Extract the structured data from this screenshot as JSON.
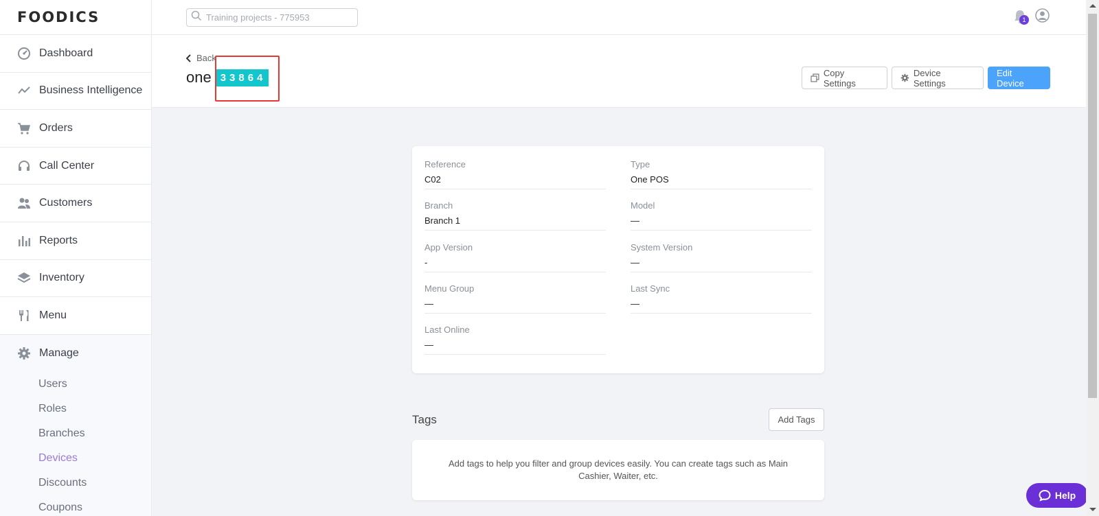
{
  "app": {
    "logo": "FOODICS"
  },
  "search": {
    "placeholder": "Training projects - 775953"
  },
  "notifications": {
    "count": "1"
  },
  "sidebar": {
    "items": [
      {
        "label": "Dashboard",
        "icon": "dashboard-icon"
      },
      {
        "label": "Business Intelligence",
        "icon": "trend-icon"
      },
      {
        "label": "Orders",
        "icon": "cart-icon"
      },
      {
        "label": "Call Center",
        "icon": "headset-icon"
      },
      {
        "label": "Customers",
        "icon": "customers-icon"
      },
      {
        "label": "Reports",
        "icon": "bar-chart-icon"
      },
      {
        "label": "Inventory",
        "icon": "layers-icon"
      },
      {
        "label": "Menu",
        "icon": "fork-knife-icon"
      }
    ],
    "manage": {
      "label": "Manage",
      "icon": "gear-icon",
      "sub_items": [
        "Users",
        "Roles",
        "Branches",
        "Devices",
        "Discounts",
        "Coupons"
      ],
      "active": "Devices"
    }
  },
  "header": {
    "back_label": "Back",
    "title": "one",
    "code": "33864",
    "buttons": {
      "copy_settings": "Copy Settings",
      "device_settings": "Device Settings",
      "edit_device": "Edit Device"
    }
  },
  "details": {
    "reference": {
      "label": "Reference",
      "value": "C02"
    },
    "type": {
      "label": "Type",
      "value": "One POS"
    },
    "branch": {
      "label": "Branch",
      "value": "Branch 1"
    },
    "model": {
      "label": "Model",
      "value": "—"
    },
    "app_version": {
      "label": "App Version",
      "value": "-"
    },
    "system_version": {
      "label": "System Version",
      "value": "—"
    },
    "menu_group": {
      "label": "Menu Group",
      "value": "—"
    },
    "last_sync": {
      "label": "Last Sync",
      "value": "—"
    },
    "last_online": {
      "label": "Last Online",
      "value": "—"
    }
  },
  "tags": {
    "title": "Tags",
    "add_label": "Add Tags",
    "empty_text": "Add tags to help you filter and group devices easily. You can create tags such as Main Cashier, Waiter, etc."
  },
  "help": {
    "label": "Help"
  },
  "colors": {
    "accent_blue": "#4ba3fb",
    "code_teal": "#12c6cc",
    "highlight_red": "#e53935",
    "help_purple": "#6a2fd6",
    "active_nav": "#9a7ad8"
  }
}
